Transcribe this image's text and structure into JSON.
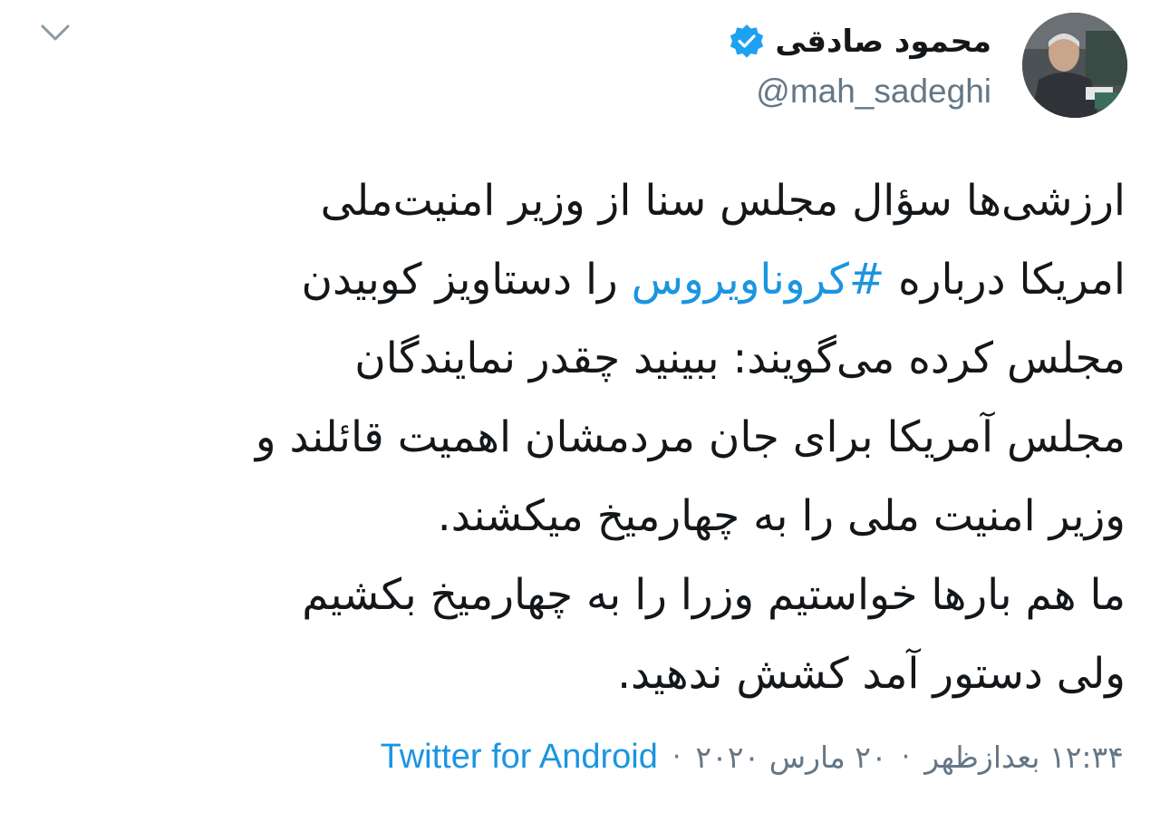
{
  "colors": {
    "text": "#14171a",
    "secondary": "#657786",
    "link": "#1b95e0",
    "verified": "#1da1f2"
  },
  "author": {
    "display_name": "محمود صادقی",
    "handle": "@mah_sadeghi",
    "verified": true,
    "avatar_icon": "profile-photo"
  },
  "icons": {
    "menu": "chevron-down-icon",
    "verified": "verified-badge-icon"
  },
  "tweet": {
    "lines": [
      [
        "ارزشی‌ها سؤال مجلس سنا از وزیر امنیت‌ملی"
      ],
      [
        "امریکا درباره ",
        "#کروناویروس",
        " را دستاویز کوبیدن"
      ],
      [
        "مجلس کرده می‌گویند: ببینید چقدر نمایندگان"
      ],
      [
        "مجلس آمریکا برای جان مردمشان اهمیت قائلند و"
      ],
      [
        "وزیر امنیت ملی را به چهارمیخ میکشند."
      ],
      [
        "ما هم بارها خواستیم وزرا را به چهارمیخ بکشیم"
      ],
      [
        "ولی دستور آمد کشش ندهید."
      ]
    ],
    "hashtag": "#کروناویروس"
  },
  "meta": {
    "time": "۱۲:۳۴ بعدازظهر",
    "date": "۲۰ مارس ۲۰۲۰",
    "separator": "·",
    "source": "Twitter for Android"
  }
}
